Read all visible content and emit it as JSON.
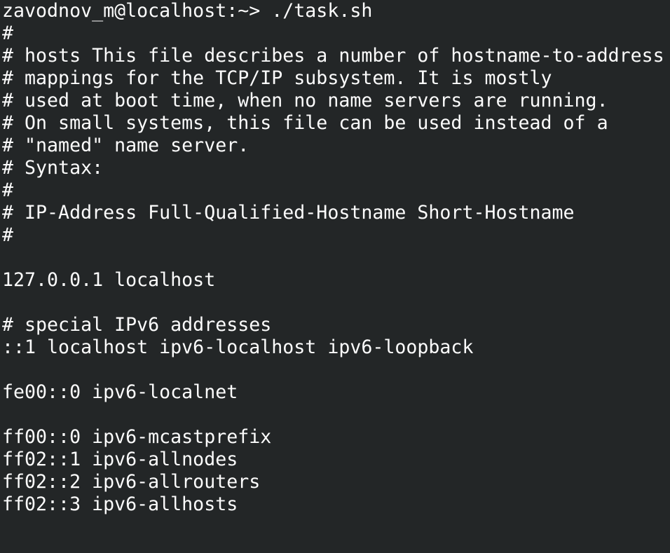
{
  "terminal": {
    "lines": [
      "zavodnov_m@localhost:~> ./task.sh",
      "#",
      "# hosts This file describes a number of hostname-to-address",
      "# mappings for the TCP/IP subsystem. It is mostly",
      "# used at boot time, when no name servers are running.",
      "# On small systems, this file can be used instead of a",
      "# \"named\" name server.",
      "# Syntax:",
      "#",
      "# IP-Address Full-Qualified-Hostname Short-Hostname",
      "#",
      "",
      "127.0.0.1 localhost",
      "",
      "# special IPv6 addresses",
      "::1 localhost ipv6-localhost ipv6-loopback",
      "",
      "fe00::0 ipv6-localnet",
      "",
      "ff00::0 ipv6-mcastprefix",
      "ff02::1 ipv6-allnodes",
      "ff02::2 ipv6-allrouters",
      "ff02::3 ipv6-allhosts"
    ],
    "colors": {
      "background": "#232627",
      "foreground": "#fcfcfc"
    }
  }
}
